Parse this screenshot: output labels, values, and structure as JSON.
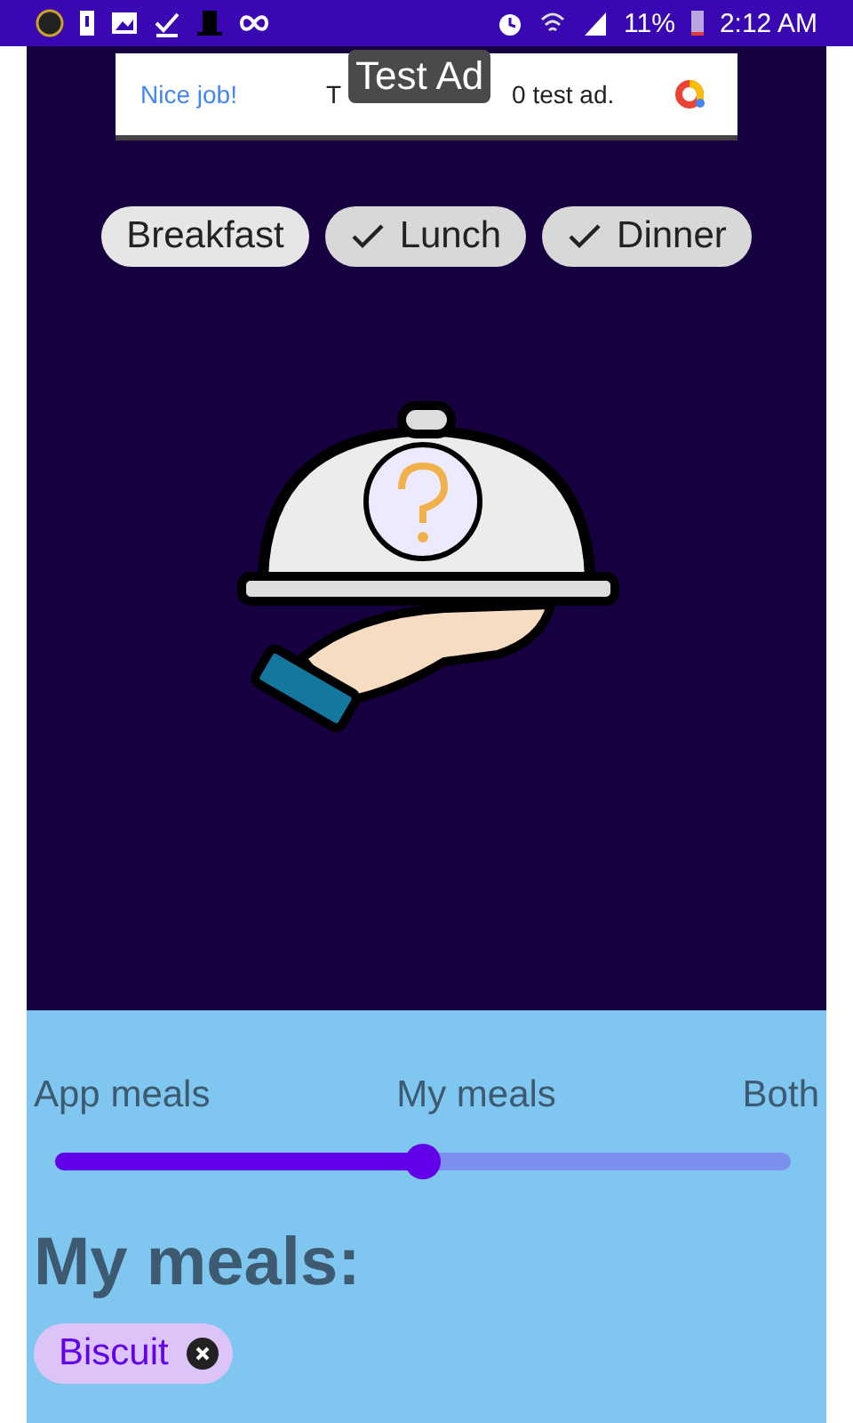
{
  "status_bar": {
    "battery_percent": "11%",
    "time": "2:12 AM"
  },
  "ad_banner": {
    "headline": "Nice job!",
    "text_before": "T",
    "text_after": "0 test ad.",
    "overlay_label": "Test Ad"
  },
  "meal_chips": [
    {
      "label": "Breakfast",
      "selected": false
    },
    {
      "label": "Lunch",
      "selected": true
    },
    {
      "label": "Dinner",
      "selected": true
    }
  ],
  "source_slider": {
    "labels": [
      "App meals",
      "My meals",
      "Both"
    ],
    "level": 0.5
  },
  "my_meals": {
    "title": "My meals:",
    "chips": [
      {
        "label": "Biscuit"
      }
    ]
  }
}
